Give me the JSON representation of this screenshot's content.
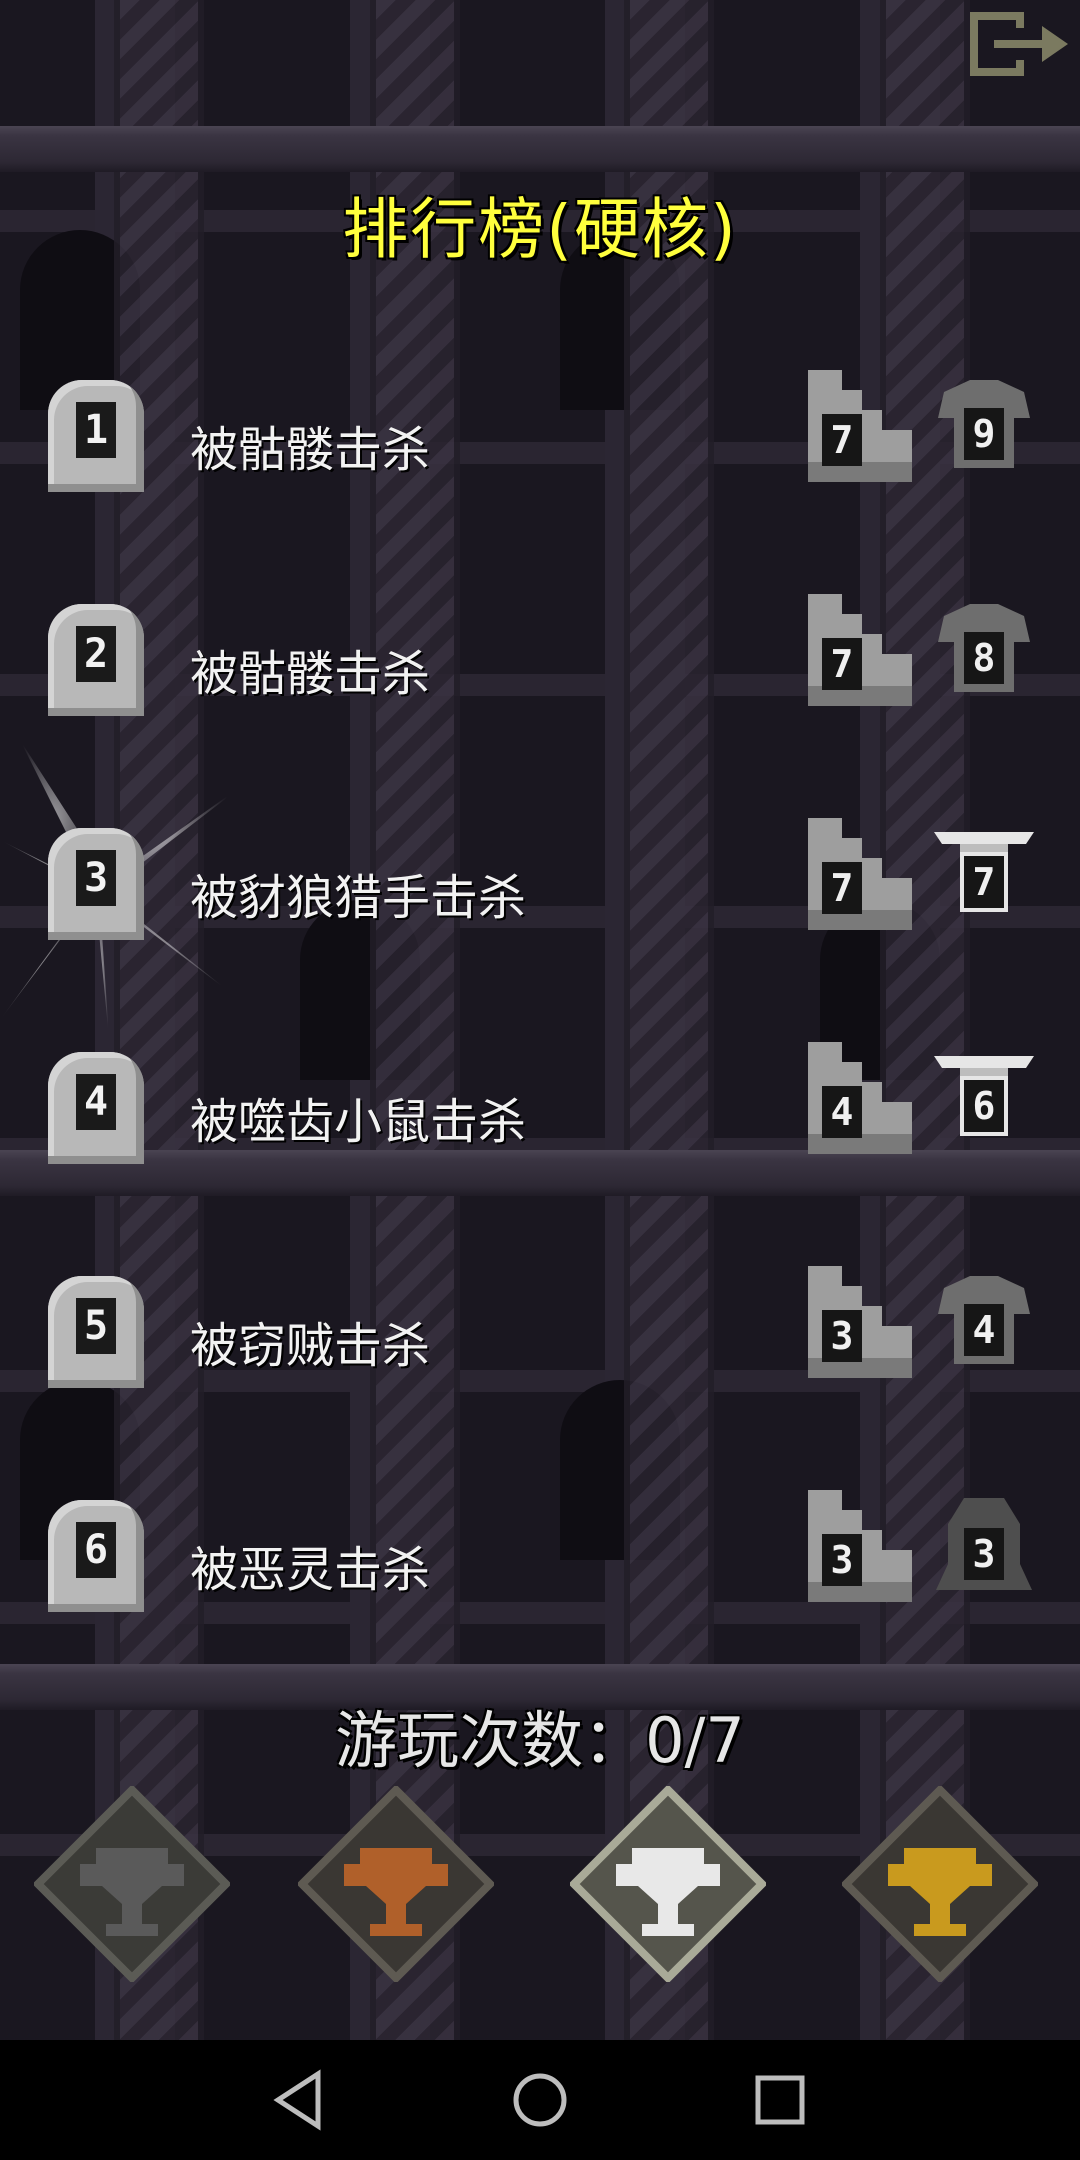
{
  "title": "排行榜(硬核)",
  "entries": [
    {
      "rank": "1",
      "cause": "被骷髅击杀",
      "depth": "7",
      "armor": "9",
      "armor_type": "cloth-shirt-icon"
    },
    {
      "rank": "2",
      "cause": "被骷髅击杀",
      "depth": "7",
      "armor": "8",
      "armor_type": "cloth-shirt-icon"
    },
    {
      "rank": "3",
      "cause": "被豺狼猎手击杀",
      "depth": "7",
      "armor": "7",
      "armor_type": "winged-armor-icon"
    },
    {
      "rank": "4",
      "cause": "被噬齿小鼠击杀",
      "depth": "4",
      "armor": "6",
      "armor_type": "winged-armor-icon"
    },
    {
      "rank": "5",
      "cause": "被窃贼击杀",
      "depth": "3",
      "armor": "4",
      "armor_type": "cloth-shirt-icon"
    },
    {
      "rank": "6",
      "cause": "被恶灵击杀",
      "depth": "3",
      "armor": "3",
      "armor_type": "hooded-robe-icon"
    }
  ],
  "games_played": "游玩次数：0/7",
  "trophies": [
    {
      "name": "trophy-gray-icon",
      "color": "#5a5a5a"
    },
    {
      "name": "trophy-bronze-icon",
      "color": "#b0602a"
    },
    {
      "name": "trophy-silver-icon",
      "color": "#e8e8e8"
    },
    {
      "name": "trophy-gold-icon",
      "color": "#c99a1e"
    }
  ],
  "colors": {
    "title": "#ffff3d",
    "text": "#f2f2f2",
    "background": "#1a1720"
  }
}
